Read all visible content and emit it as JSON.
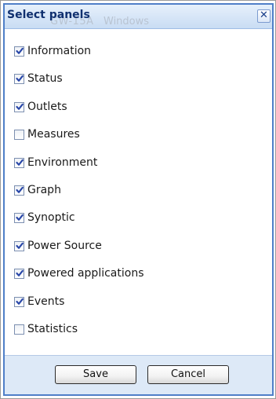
{
  "dialog": {
    "title": "Select panels",
    "close_glyph": "✕",
    "background_text": [
      "GW-15A",
      "Windows"
    ],
    "accent_color": "#4f7fc8"
  },
  "panels": [
    {
      "label": "Information",
      "checked": true
    },
    {
      "label": "Status",
      "checked": true
    },
    {
      "label": "Outlets",
      "checked": true
    },
    {
      "label": "Measures",
      "checked": false
    },
    {
      "label": "Environment",
      "checked": true
    },
    {
      "label": "Graph",
      "checked": true
    },
    {
      "label": "Synoptic",
      "checked": true
    },
    {
      "label": "Power Source",
      "checked": true
    },
    {
      "label": "Powered applications",
      "checked": true
    },
    {
      "label": "Events",
      "checked": true
    },
    {
      "label": "Statistics",
      "checked": false
    }
  ],
  "buttons": {
    "save_label": "Save",
    "cancel_label": "Cancel"
  }
}
